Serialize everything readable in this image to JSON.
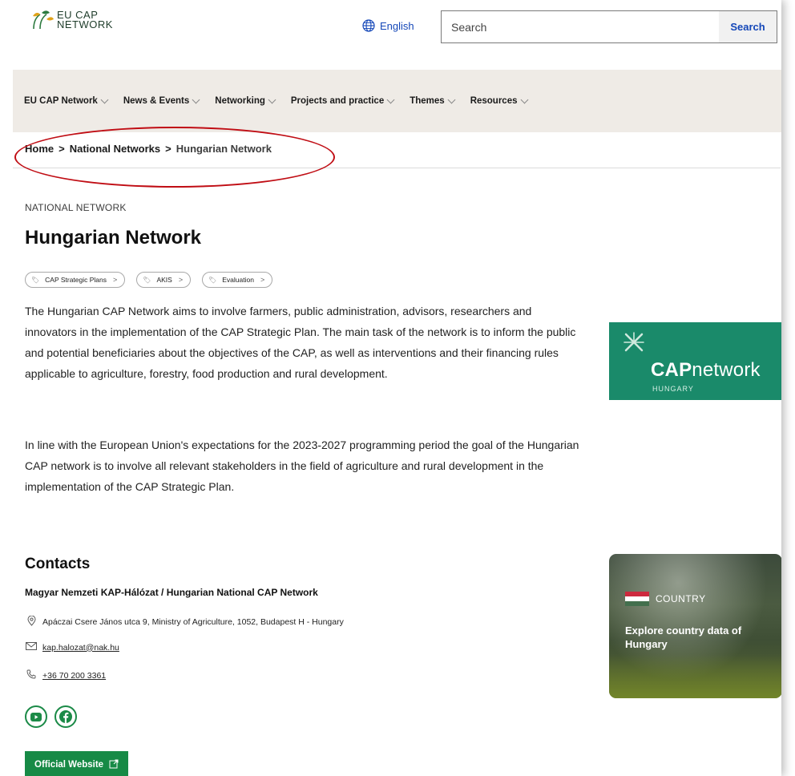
{
  "header": {
    "logo_line1": "EU CAP",
    "logo_line2": "NETWORK",
    "language": "English",
    "search_placeholder": "Search",
    "search_button": "Search"
  },
  "nav": {
    "items": [
      {
        "label": "EU CAP Network"
      },
      {
        "label": "News & Events"
      },
      {
        "label": "Networking"
      },
      {
        "label": "Projects and practice"
      },
      {
        "label": "Themes"
      },
      {
        "label": "Resources"
      }
    ]
  },
  "breadcrumb": {
    "home": "Home",
    "sep": ">",
    "level1": "National Networks",
    "current": "Hungarian Network"
  },
  "page": {
    "kicker": "NATIONAL NETWORK",
    "title": "Hungarian Network",
    "tags": [
      {
        "label": "CAP Strategic Plans"
      },
      {
        "label": "AKIS"
      },
      {
        "label": "Evaluation"
      }
    ],
    "paragraph1": "The Hungarian CAP Network aims to involve farmers, public administration, advisors, researchers and innovators in the implementation of the CAP Strategic Plan. The main task of the network is to inform the public and potential beneficiaries about the objectives of the CAP, as well as interventions and their financing rules applicable to agriculture, forestry, food production and rural development.",
    "paragraph2": "In line with the European Union's expectations for the 2023-2027 programming period the goal of the Hungarian CAP network is to involve all relevant stakeholders in the field of agriculture and rural development in the implementation of the CAP Strategic Plan."
  },
  "cap_logo": {
    "word_bold": "CAP",
    "word_light": "network",
    "sub": "HUNGARY"
  },
  "contacts": {
    "heading": "Contacts",
    "org": "Magyar Nemzeti KAP-Hálózat / Hungarian National CAP Network",
    "address": "Apáczai Csere János utca 9, Ministry of Agriculture, 1052, Budapest H - Hungary",
    "email": "kap.halozat@nak.hu",
    "phone": "+36 70 200 3361",
    "official_button": "Official Website"
  },
  "country_card": {
    "label": "COUNTRY",
    "text": "Explore country data of Hungary",
    "flag_colors": [
      "#cd2a3e",
      "#ffffff",
      "#436f4d"
    ]
  },
  "colors": {
    "accent_green": "#178a46",
    "link_blue": "#1447b8",
    "highlight_red": "#c00d14",
    "nav_bg": "#efebe6"
  }
}
